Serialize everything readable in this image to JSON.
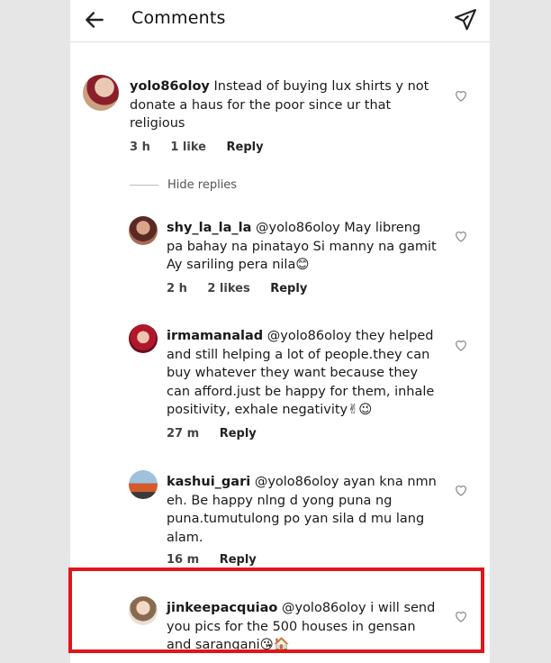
{
  "header": {
    "title": "Comments",
    "back_icon": "arrow-left-icon",
    "send_icon": "paper-plane-icon"
  },
  "comments": [
    {
      "username": "yolo86oloy",
      "text": "Instead of buying lux shirts y not donate a haus for the poor since ur that religious",
      "time": "3 h",
      "likes": "1 like",
      "reply": "Reply"
    }
  ],
  "hide_replies": "Hide replies",
  "replies": [
    {
      "username": "shy_la_la_la",
      "text": "@yolo86oloy May libreng pa bahay na pinatayo Si manny na gamit Ay sariling pera nila😊",
      "time": "2 h",
      "likes": "2 likes",
      "reply": "Reply"
    },
    {
      "username": "irmamanalad",
      "text": "@yolo86oloy they helped and still helping a lot of people.they can buy whatever they want because they can afford.just be happy for them, inhale positivity, exhale negativity✌😉",
      "time": "27 m",
      "reply": "Reply"
    },
    {
      "username": "kashui_gari",
      "text": "@yolo86oloy ayan kna nmn eh. Be happy nlng d yong puna ng puna.tumutulong po yan sila d mu lang alam.",
      "time": "16 m",
      "reply": "Reply"
    },
    {
      "username": "jinkeepacquiao",
      "text": "@yolo86oloy i will send you pics for the 500 houses in gensan and sarangani😘🏠"
    }
  ],
  "colors": {
    "highlight_border": "#e0161b",
    "background": "#ffffff"
  }
}
